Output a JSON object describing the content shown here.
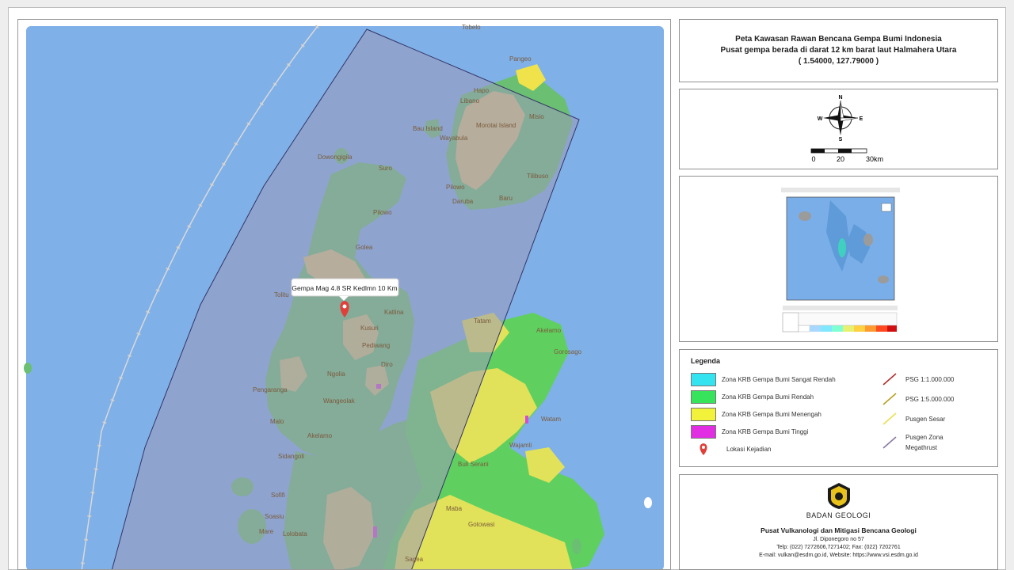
{
  "title": {
    "line1": "Peta Kawasan Rawan Bencana Gempa Bumi Indonesia",
    "line2": "Pusat gempa berada di darat 12 km barat laut Halmahera Utara",
    "line3": "( 1.54000, 127.79000 )"
  },
  "compass": {
    "north": "N",
    "south": "S",
    "east": "E",
    "west": "W",
    "scale_ticks": [
      "0",
      "20",
      "30km"
    ]
  },
  "map": {
    "epicenter_label": "Gempa Mag 4.8 SR Kedlmn 10 Km",
    "place_names": [
      "Pangeo",
      "Hapo",
      "Libano",
      "Misio",
      "Morotai Island",
      "Bau Island",
      "Wayabula",
      "Dowongigila",
      "Suro",
      "Pilowo",
      "Tilibuso",
      "Daruba",
      "Baru",
      "Pilowo",
      "Golea",
      "Tolitu",
      "Katlina",
      "Kusuri",
      "Pediwang",
      "Diro",
      "Ngolia",
      "Pengaranga",
      "Wangeolak",
      "Malo",
      "Akelamo",
      "Sidangoli",
      "Sofifi",
      "Soasiu",
      "Mare",
      "Lolobata",
      "Tatam",
      "Akelamo",
      "Gorosago",
      "Watam",
      "Wajamli",
      "Buli Serani",
      "Maba",
      "Gotowasi",
      "Sagea",
      "Tobelo"
    ],
    "colors": {
      "sea": "#7fb0e8",
      "low": "#6abf73",
      "medium": "#d7c47a",
      "high": "#d64ad6",
      "zone_overlay": "#9a9ab8"
    }
  },
  "legend": {
    "title": "Legenda",
    "zones": [
      {
        "label": "Zona KRB Gempa Bumi Sangat Rendah",
        "color": "#33e3f0"
      },
      {
        "label": "Zona KRB Gempa Bumi Rendah",
        "color": "#36e35a"
      },
      {
        "label": "Zona KRB Gempa Bumi Menengah",
        "color": "#f2f23a"
      },
      {
        "label": "Zona KRB Gempa Bumi Tinggi",
        "color": "#e22ee2"
      }
    ],
    "location_label": "Lokasi Kejadian",
    "lines": [
      {
        "label": "PSG 1:1.000.000",
        "color": "#b03030"
      },
      {
        "label": "PSG 1:5.000.000",
        "color": "#b6a020"
      },
      {
        "label": "Pusgen Sesar",
        "color": "#e8e050"
      },
      {
        "label": "Pusgen Zona Megathrust",
        "color": "#8a7aa0"
      }
    ]
  },
  "agency": {
    "name": "BADAN GEOLOGI",
    "center": "Pusat Vulkanologi dan Mitigasi Bencana Geologi",
    "address": "Jl. Diponegoro no 57",
    "phone": "Telp: (022) 7272606,7271402; Fax: (022) 7202761",
    "email": "E-mail: vulkan@esdm.go.id, Website: https://www.vsi.esdm.go.id"
  }
}
